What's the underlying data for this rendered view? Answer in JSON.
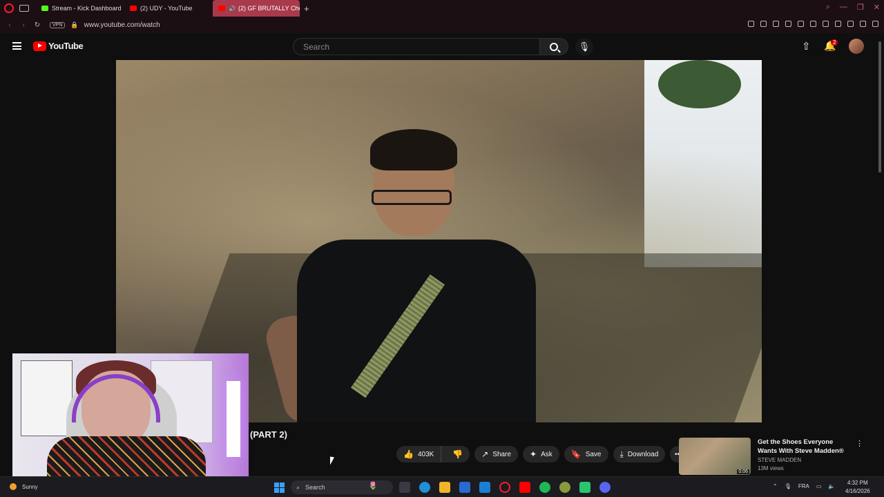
{
  "browser": {
    "tabs": [
      {
        "title": "Stream - Kick Dashboard",
        "favicon_color": "#53fc18",
        "active": false
      },
      {
        "title": "(2) UDY - YouTube",
        "favicon_color": "#ff0000",
        "active": false
      },
      {
        "title": "(2) GF BRUTALLY Che",
        "favicon_color": "#ff0000",
        "active": true
      }
    ],
    "vpn_label": "VPN",
    "url": "www.youtube.com/watch"
  },
  "youtube": {
    "logo_text": "YouTube",
    "search_placeholder": "Search",
    "notification_count": "2"
  },
  "video": {
    "title_fragment": "(PART 2)"
  },
  "actions": {
    "like_count": "403K",
    "share_label": "Share",
    "ask_label": "Ask",
    "save_label": "Save",
    "download_label": "Download"
  },
  "ad": {
    "title": "Get the Shoes Everyone Wants With Steve Madden®",
    "channel": "STEVE MADDEN",
    "views": "13M views",
    "duration": "0:06"
  },
  "taskbar": {
    "weather": "Sunny",
    "search_label": "Search",
    "language": "FRA",
    "time": "4:32 PM",
    "date": "4/16/2026"
  },
  "colors": {
    "accent_red": "#ff0000",
    "active_tab": "#a83a4b",
    "kick_green": "#53fc18"
  }
}
